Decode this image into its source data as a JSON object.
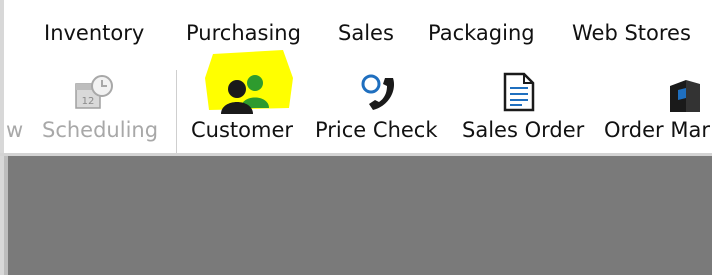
{
  "menu": {
    "items": [
      "Inventory",
      "Purchasing",
      "Sales",
      "Packaging",
      "Web Stores"
    ]
  },
  "ribbon": {
    "partial_left_label": "w",
    "scheduling_label": "Scheduling",
    "customer_label": "Customer",
    "price_check_label": "Price Check",
    "sales_order_label": "Sales Order",
    "order_manager_label": "Order Mar"
  },
  "colors": {
    "highlight": "#ffff00",
    "customer_green": "#2e9b2e",
    "icon_blue": "#1f6fbf",
    "workspace": "#7a7a7a"
  },
  "icons": {
    "scheduling": "calendar-clock-icon",
    "customer": "customers-icon",
    "price_check": "phone-icon",
    "sales_order": "document-icon",
    "order_manager": "order-manager-icon"
  }
}
